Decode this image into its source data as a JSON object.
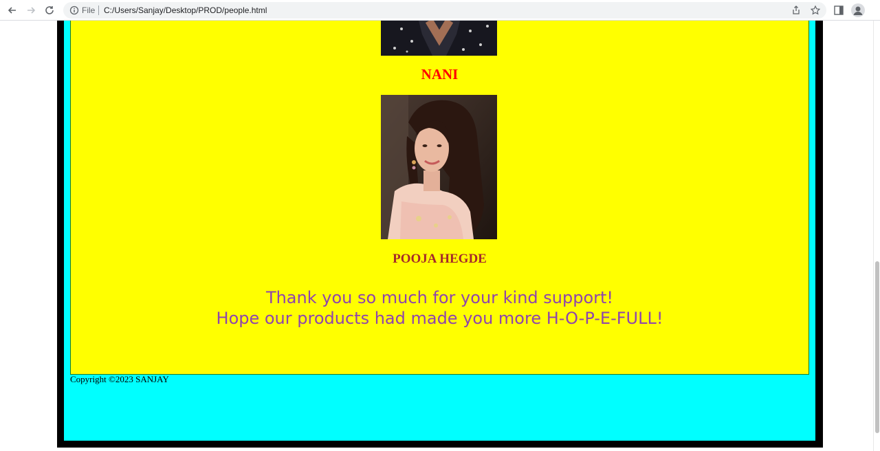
{
  "browser": {
    "url_scheme_label": "File",
    "url": "C:/Users/Sanjay/Desktop/PROD/people.html"
  },
  "people": [
    {
      "name": "NANI"
    },
    {
      "name": "POOJA HEGDE"
    }
  ],
  "message": {
    "line1": "Thank you so much for your kind support!",
    "line2": "Hope our products had made you more H-O-P-E-FULL!"
  },
  "footer": {
    "copyright": "Copyright ©2023 SANJAY"
  },
  "colors": {
    "page_border": "#000000",
    "page_bg": "#00ffff",
    "panel_bg": "#ffff00",
    "nani_name": "#ff0000",
    "pooja_name": "#a52a2a",
    "message": "#8e44ad"
  }
}
